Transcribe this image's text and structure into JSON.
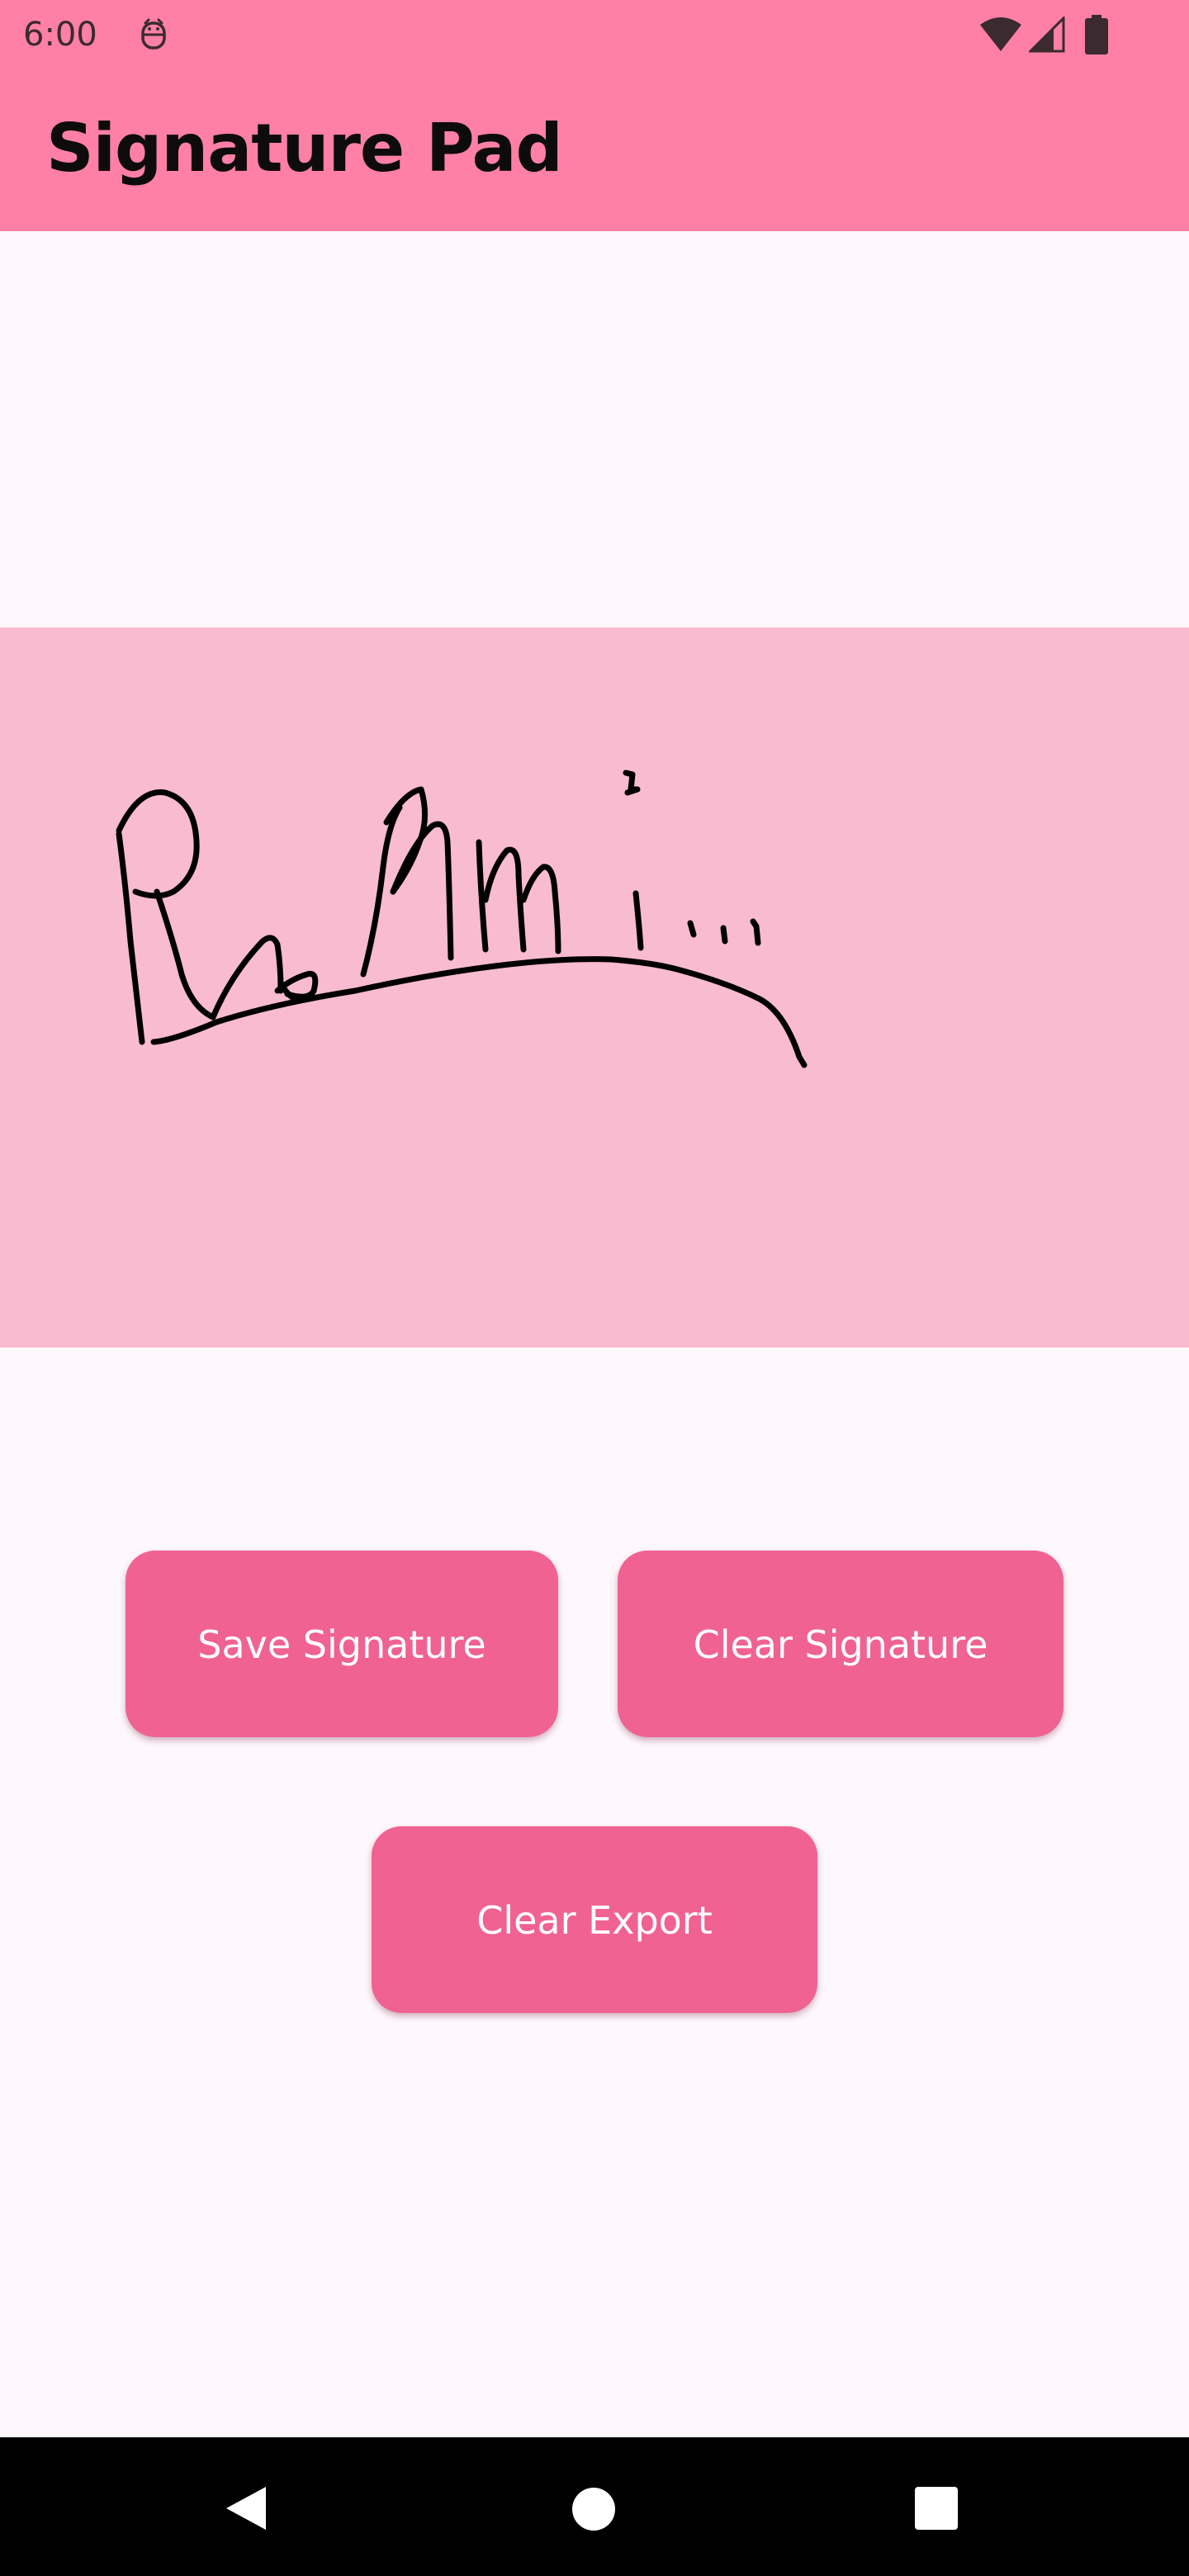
{
  "status_bar": {
    "time": "6:00",
    "icons": [
      "debug-icon",
      "wifi-icon",
      "cellular-signal-icon",
      "battery-icon"
    ]
  },
  "app_bar": {
    "title": "Signature Pad",
    "color": "#ff80a6"
  },
  "signature_pad": {
    "background": "#f8bbd0",
    "stroke_color": "#000000"
  },
  "buttons": {
    "save_label": "Save Signature",
    "clear_signature_label": "Clear Signature",
    "clear_export_label": "Clear Export",
    "color": "#f06292"
  },
  "nav_bar": {
    "icons": [
      "back-icon",
      "home-icon",
      "recents-icon"
    ]
  }
}
